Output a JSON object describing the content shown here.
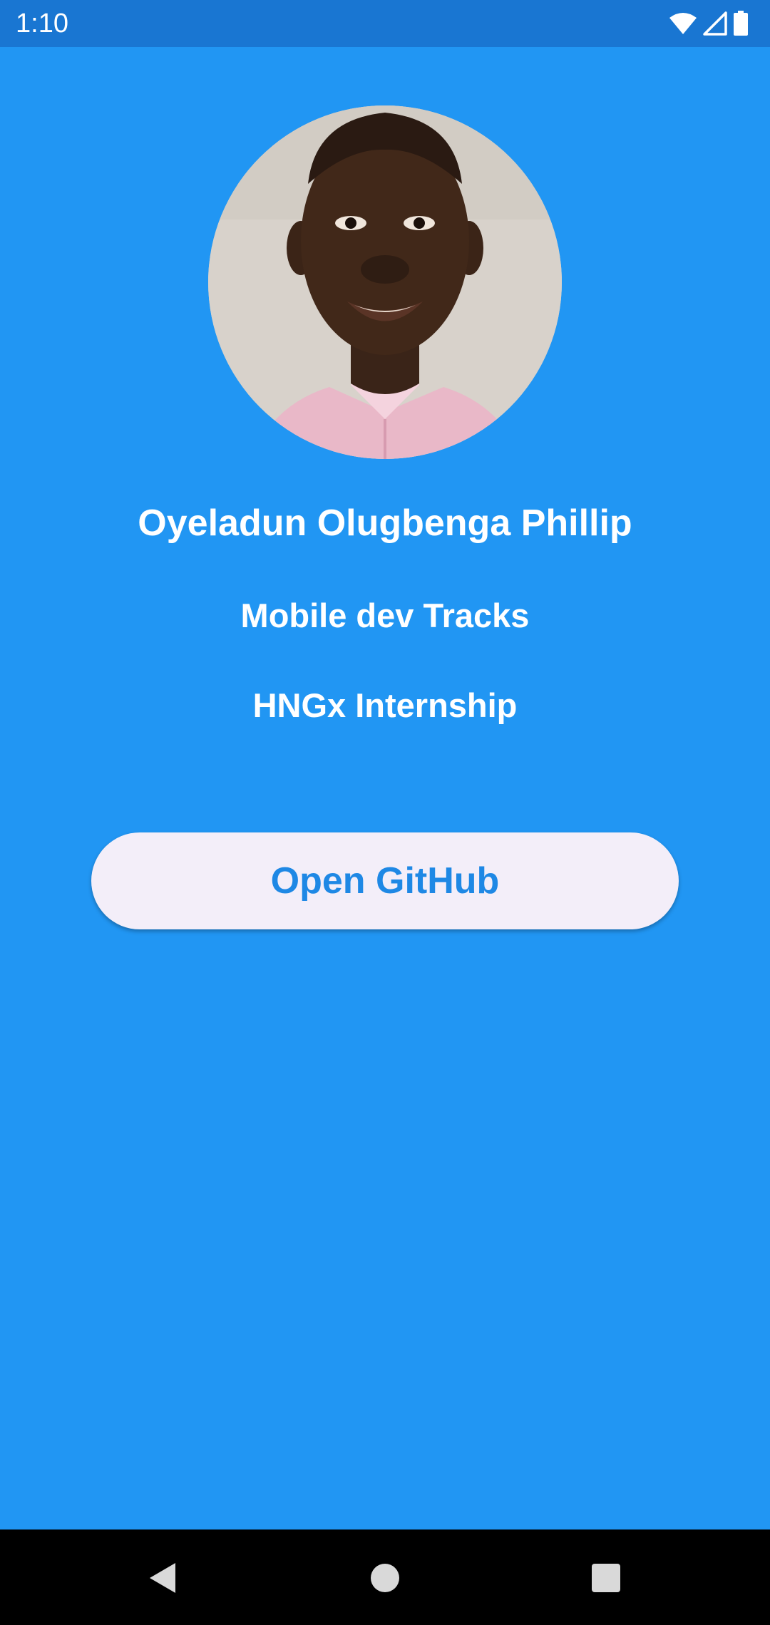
{
  "status_bar": {
    "time": "1:10",
    "icons": [
      "wifi-icon",
      "cellular-signal-icon",
      "battery-icon"
    ]
  },
  "profile": {
    "avatar": "profile-photo",
    "name": "Oyeladun Olugbenga Phillip",
    "track": "Mobile dev Tracks",
    "program": "HNGx Internship"
  },
  "actions": {
    "open_github_label": "Open GitHub"
  },
  "navigation_bar": {
    "buttons": [
      "back-icon",
      "home-icon",
      "recents-icon"
    ]
  },
  "colors": {
    "background": "#2196F3",
    "status_bar": "#1976D2",
    "button_background": "#F3EEF9",
    "button_text": "#1E88E5",
    "text": "#FFFFFF"
  }
}
